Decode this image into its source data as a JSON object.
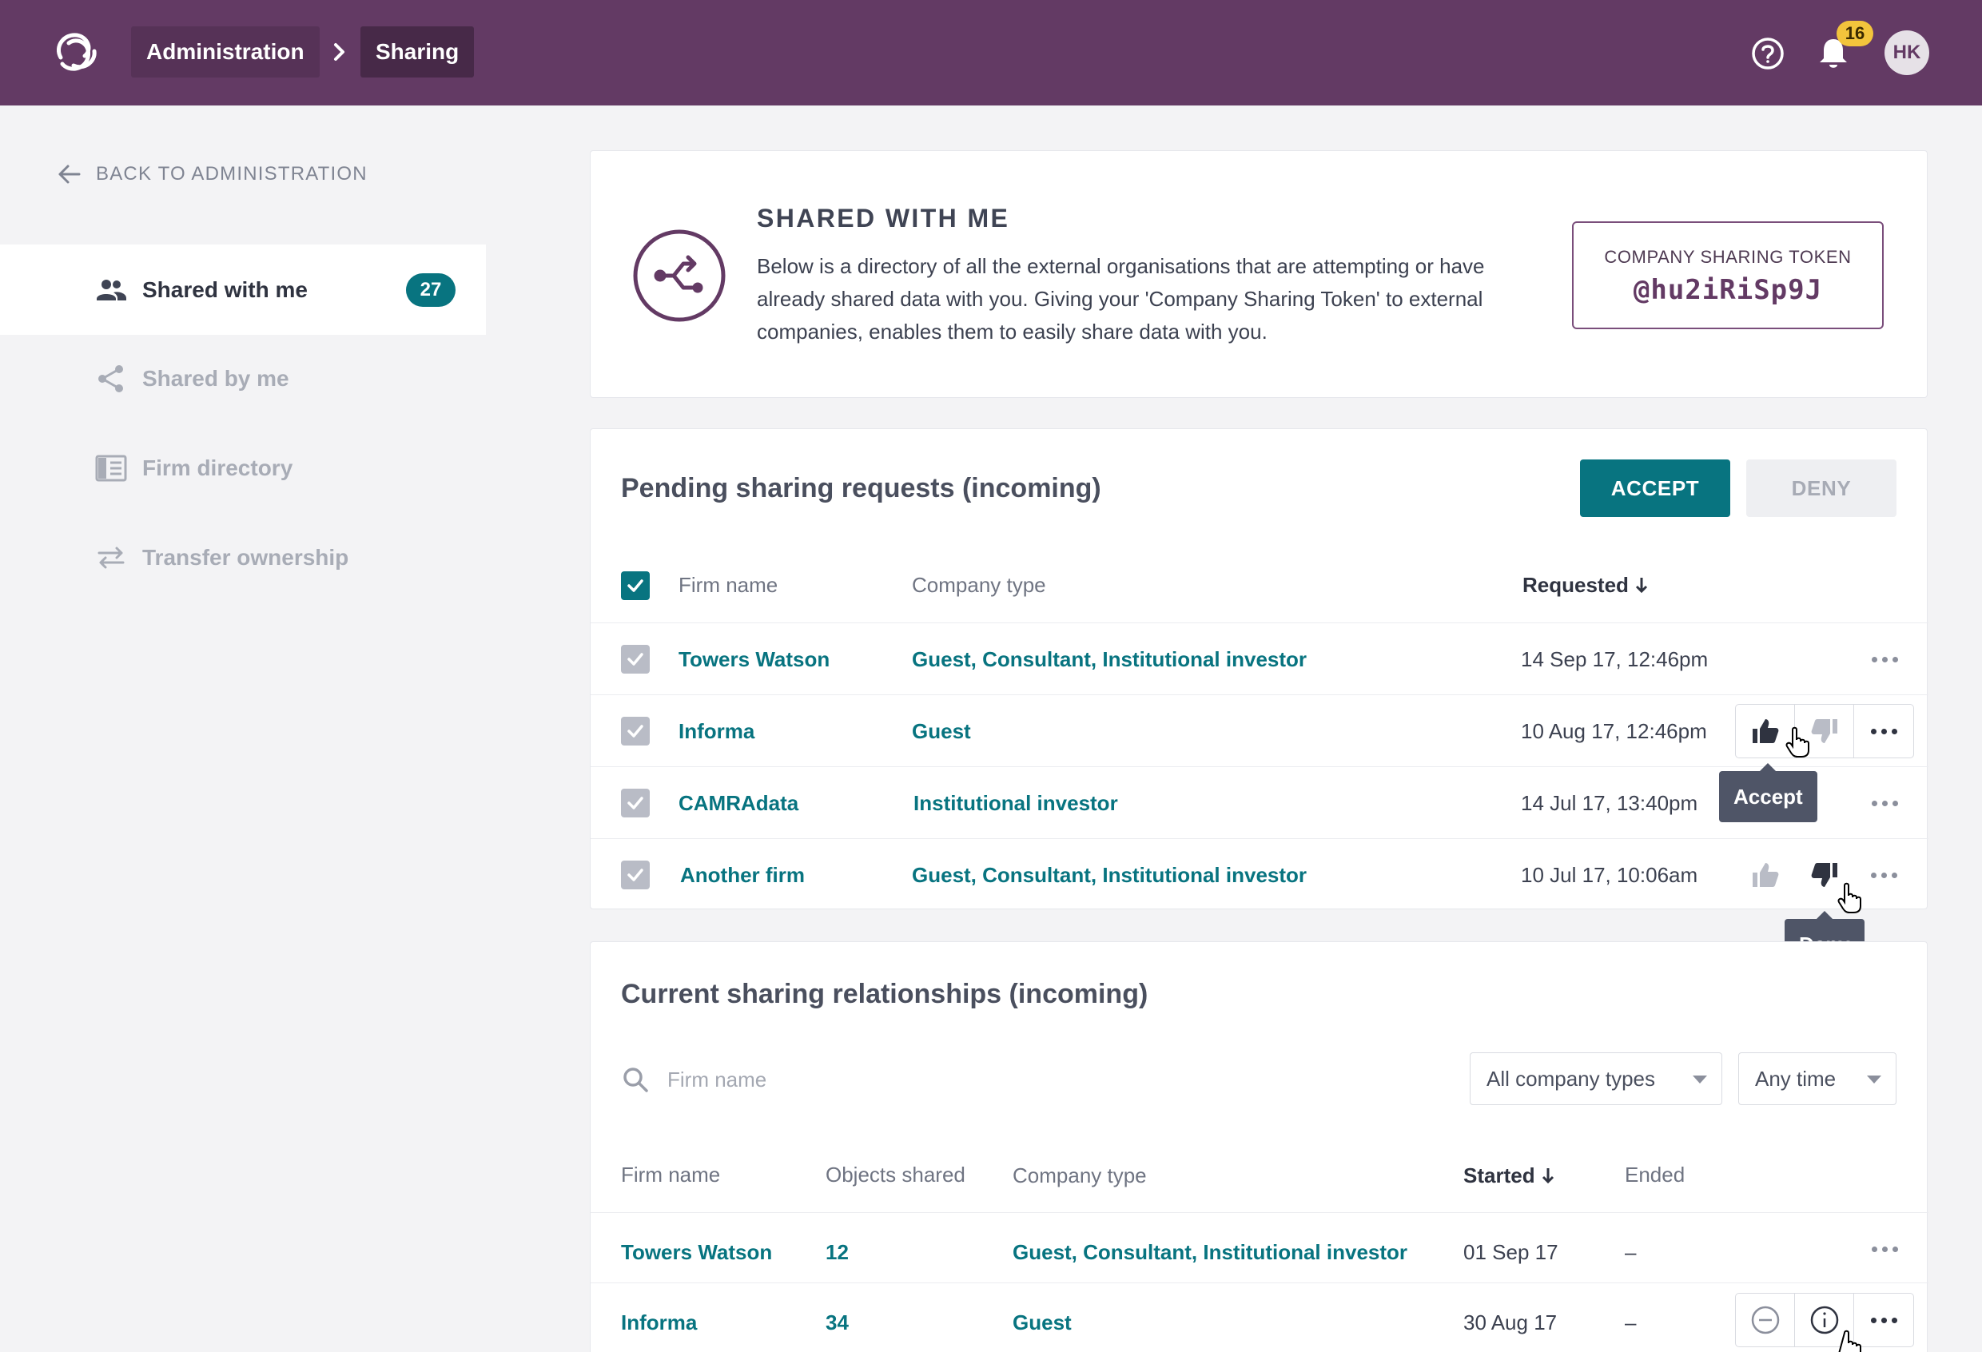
{
  "topbar": {
    "breadcrumb_admin": "Administration",
    "breadcrumb_current": "Sharing",
    "notifications_count": "16",
    "avatar_initials": "HK",
    "color": "#633a64"
  },
  "sidebar": {
    "back_label": "BACK TO ADMINISTRATION",
    "items": [
      {
        "label": "Shared with me",
        "badge": "27",
        "active": true,
        "icon": "users-icon"
      },
      {
        "label": "Shared by me",
        "icon": "share-icon"
      },
      {
        "label": "Firm directory",
        "icon": "directory-icon"
      },
      {
        "label": "Transfer ownership",
        "icon": "transfer-icon"
      }
    ]
  },
  "intro": {
    "title": "SHARED WITH ME",
    "description": "Below is a directory of all the external organisations that are attempting or have already shared data with you. Giving your 'Company Sharing Token' to external companies, enables them to easily share data with you.",
    "token_label": "COMPANY SHARING TOKEN",
    "token_value": "@hu2iRiSp9J"
  },
  "pending": {
    "title": "Pending sharing requests (incoming)",
    "accept_label": "ACCEPT",
    "deny_label": "DENY",
    "columns": {
      "firm": "Firm name",
      "type": "Company type",
      "requested": "Requested"
    },
    "rows": [
      {
        "firm": "Towers Watson",
        "type": "Guest, Consultant, Institutional investor",
        "requested": "14 Sep 17, 12:46pm"
      },
      {
        "firm": "Informa",
        "type": "Guest",
        "requested": "10 Aug 17, 12:46pm"
      },
      {
        "firm": "CAMRAdata",
        "type": "Institutional investor",
        "requested": "14 Jul 17, 13:40pm"
      },
      {
        "firm": "Another firm",
        "type": "Guest, Consultant, Institutional investor",
        "requested": "10 Jul 17, 10:06am"
      }
    ],
    "tooltip_accept": "Accept",
    "tooltip_deny": "Deny"
  },
  "current": {
    "title": "Current sharing relationships (incoming)",
    "search_placeholder": "Firm name",
    "filter_type": "All company types",
    "filter_time": "Any time",
    "columns": {
      "firm": "Firm name",
      "objects": "Objects shared",
      "type": "Company type",
      "started": "Started",
      "ended": "Ended"
    },
    "rows": [
      {
        "firm": "Towers Watson",
        "objects": "12",
        "type": "Guest, Consultant, Institutional investor",
        "started": "01 Sep 17",
        "ended": "–"
      },
      {
        "firm": "Informa",
        "objects": "34",
        "type": "Guest",
        "started": "30 Aug 17",
        "ended": "–"
      }
    ]
  },
  "colors": {
    "accent": "#087480",
    "brand": "#633a64",
    "badge": "#f3c43c"
  }
}
